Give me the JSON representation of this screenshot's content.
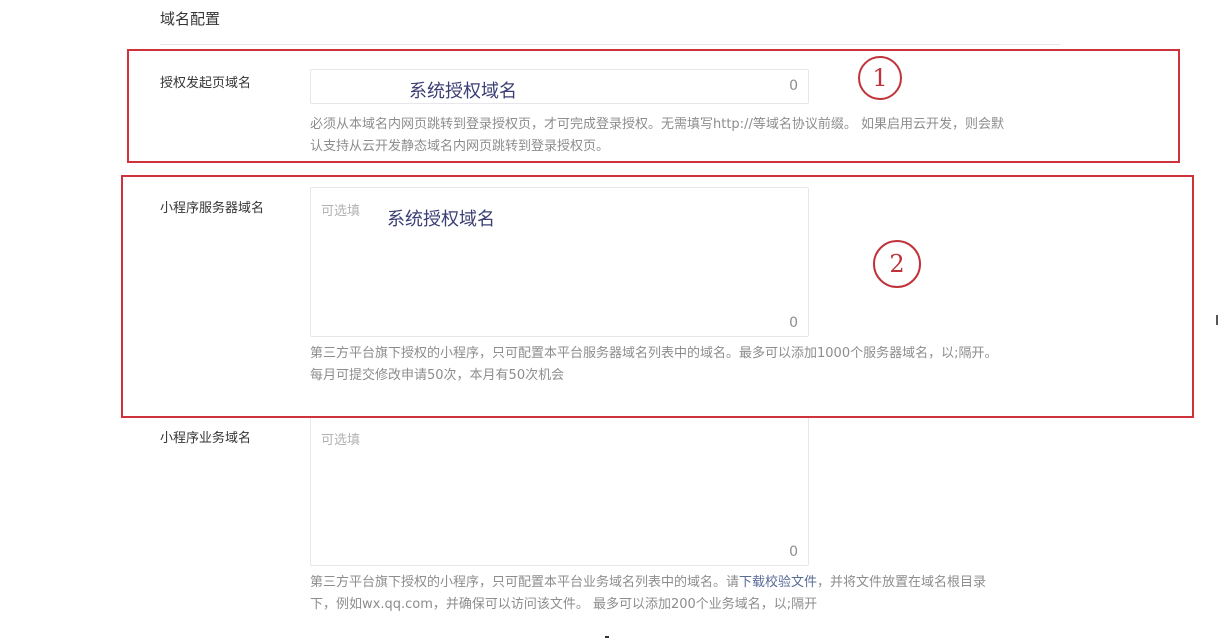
{
  "section": {
    "title": "域名配置"
  },
  "auth_domain": {
    "label": "授权发起页域名",
    "value": "",
    "count": "0",
    "overlay": "系统授权域名",
    "help_line1": "必须从本域名内网页跳转到登录授权页，才可完成登录授权。无需填写http://等域名协议前缀。 如果启用云开发，则会默",
    "help_line2": "认支持从云开发静态域名内网页跳转到登录授权页。"
  },
  "server_domain": {
    "label": "小程序服务器域名",
    "placeholder": "可选填",
    "count": "0",
    "overlay": "系统授权域名",
    "help_line1": "第三方平台旗下授权的小程序，只可配置本平台服务器域名列表中的域名。最多可以添加1000个服务器域名，以;隔开。",
    "help_line2": "每月可提交修改申请50次，本月有50次机会"
  },
  "business_domain": {
    "label": "小程序业务域名",
    "placeholder": "可选填",
    "count": "0",
    "help_line1_a": "第三方平台旗下授权的小程序，只可配置本平台业务域名列表中的域名。请",
    "help_link": "下载校验文件",
    "help_line1_b": "，并将文件放置在域名根目录",
    "help_line2": "下，例如wx.qq.com，并确保可以访问该文件。 最多可以添加200个业务域名，以;隔开"
  },
  "annotations": {
    "marker1": "1",
    "marker2": "2",
    "color": "#d0323b"
  },
  "colors": {
    "label": "#353535",
    "help": "#8d8d8d",
    "link": "#576b95",
    "border": "#e7e7eb",
    "overlay": "#3b3e75"
  }
}
